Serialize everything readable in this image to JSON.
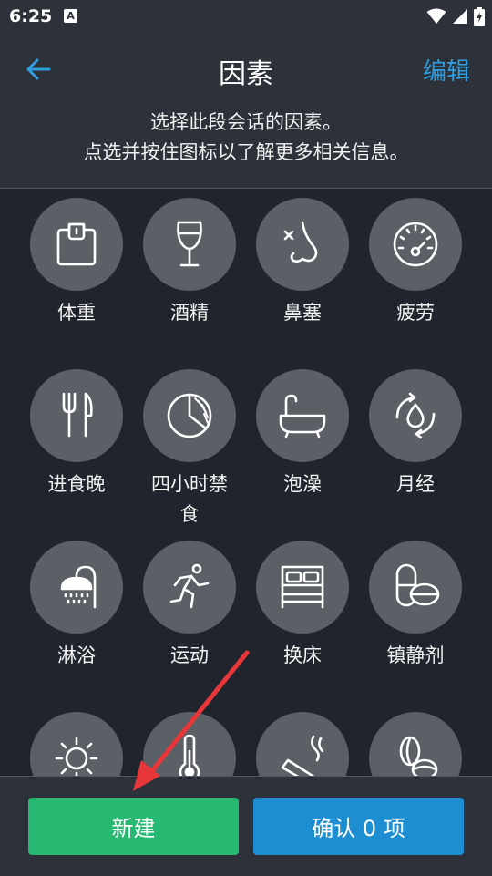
{
  "status": {
    "time": "6:25",
    "notif_letter": "A"
  },
  "header": {
    "title": "因素",
    "edit_label": "编辑",
    "description_line1": "选择此段会话的因素。",
    "description_line2": "点选并按住图标以了解更多相关信息。"
  },
  "factors": [
    {
      "label": "体重",
      "icon": "scale-icon"
    },
    {
      "label": "酒精",
      "icon": "wine-glass-icon"
    },
    {
      "label": "鼻塞",
      "icon": "nose-icon"
    },
    {
      "label": "疲劳",
      "icon": "gauge-icon"
    },
    {
      "label": "进食晚",
      "icon": "fork-knife-icon"
    },
    {
      "label": "四小时禁食",
      "icon": "clock-pie-icon"
    },
    {
      "label": "泡澡",
      "icon": "bathtub-icon"
    },
    {
      "label": "月经",
      "icon": "drop-cycle-icon"
    },
    {
      "label": "淋浴",
      "icon": "shower-icon"
    },
    {
      "label": "运动",
      "icon": "runner-icon"
    },
    {
      "label": "换床",
      "icon": "bed-icon"
    },
    {
      "label": "镇静剂",
      "icon": "pills-icon"
    },
    {
      "label": "",
      "icon": "sun-icon"
    },
    {
      "label": "",
      "icon": "thermometer-icon"
    },
    {
      "label": "",
      "icon": "cigarette-icon"
    },
    {
      "label": "",
      "icon": "coffee-bean-icon"
    }
  ],
  "buttons": {
    "new_label": "新建",
    "confirm_label": "确认 0 项"
  },
  "colors": {
    "accent": "#2f9ee0",
    "new_button": "#27b872",
    "confirm_button": "#1e8ed3",
    "annotation_arrow": "#e8373a"
  }
}
